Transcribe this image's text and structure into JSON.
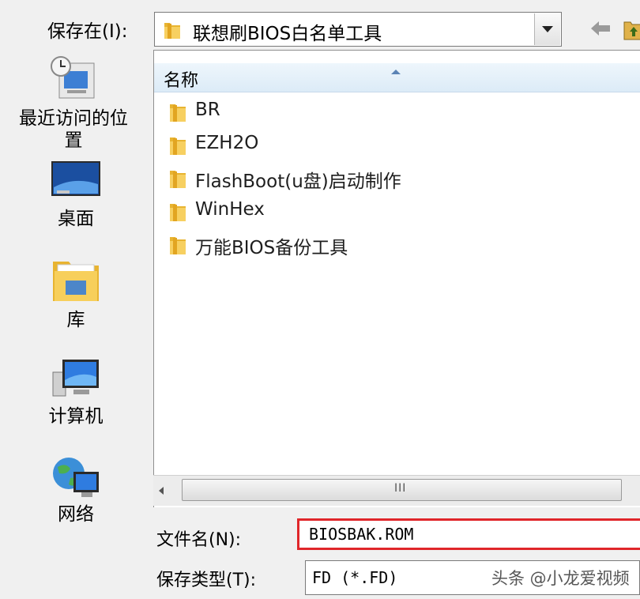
{
  "toolbar": {
    "save_in_label": "保存在(I):",
    "location": "联想刷BIOS白名单工具"
  },
  "places": [
    {
      "label": "最近访问的位置",
      "icon": "recent-places-icon"
    },
    {
      "label": "桌面",
      "icon": "desktop-icon"
    },
    {
      "label": "库",
      "icon": "library-icon"
    },
    {
      "label": "计算机",
      "icon": "computer-icon"
    },
    {
      "label": "网络",
      "icon": "network-icon"
    }
  ],
  "file_list": {
    "column_name": "名称",
    "items": [
      {
        "name": "BR",
        "type": "folder"
      },
      {
        "name": "EZH2O",
        "type": "folder"
      },
      {
        "name": "FlashBoot(u盘)启动制作",
        "type": "folder"
      },
      {
        "name": "WinHex",
        "type": "folder"
      },
      {
        "name": "万能BIOS备份工具",
        "type": "folder"
      }
    ]
  },
  "scrollbar": {
    "grip": "III"
  },
  "form": {
    "filename_label": "文件名(N):",
    "filename_value": "BIOSBAK.ROM",
    "filetype_label": "保存类型(T):",
    "filetype_value": "FD (*.FD)"
  },
  "watermark": "头条 @小龙爱视频",
  "colors": {
    "highlight_border": "#e0262a",
    "header_blue": "#dcebf7"
  }
}
